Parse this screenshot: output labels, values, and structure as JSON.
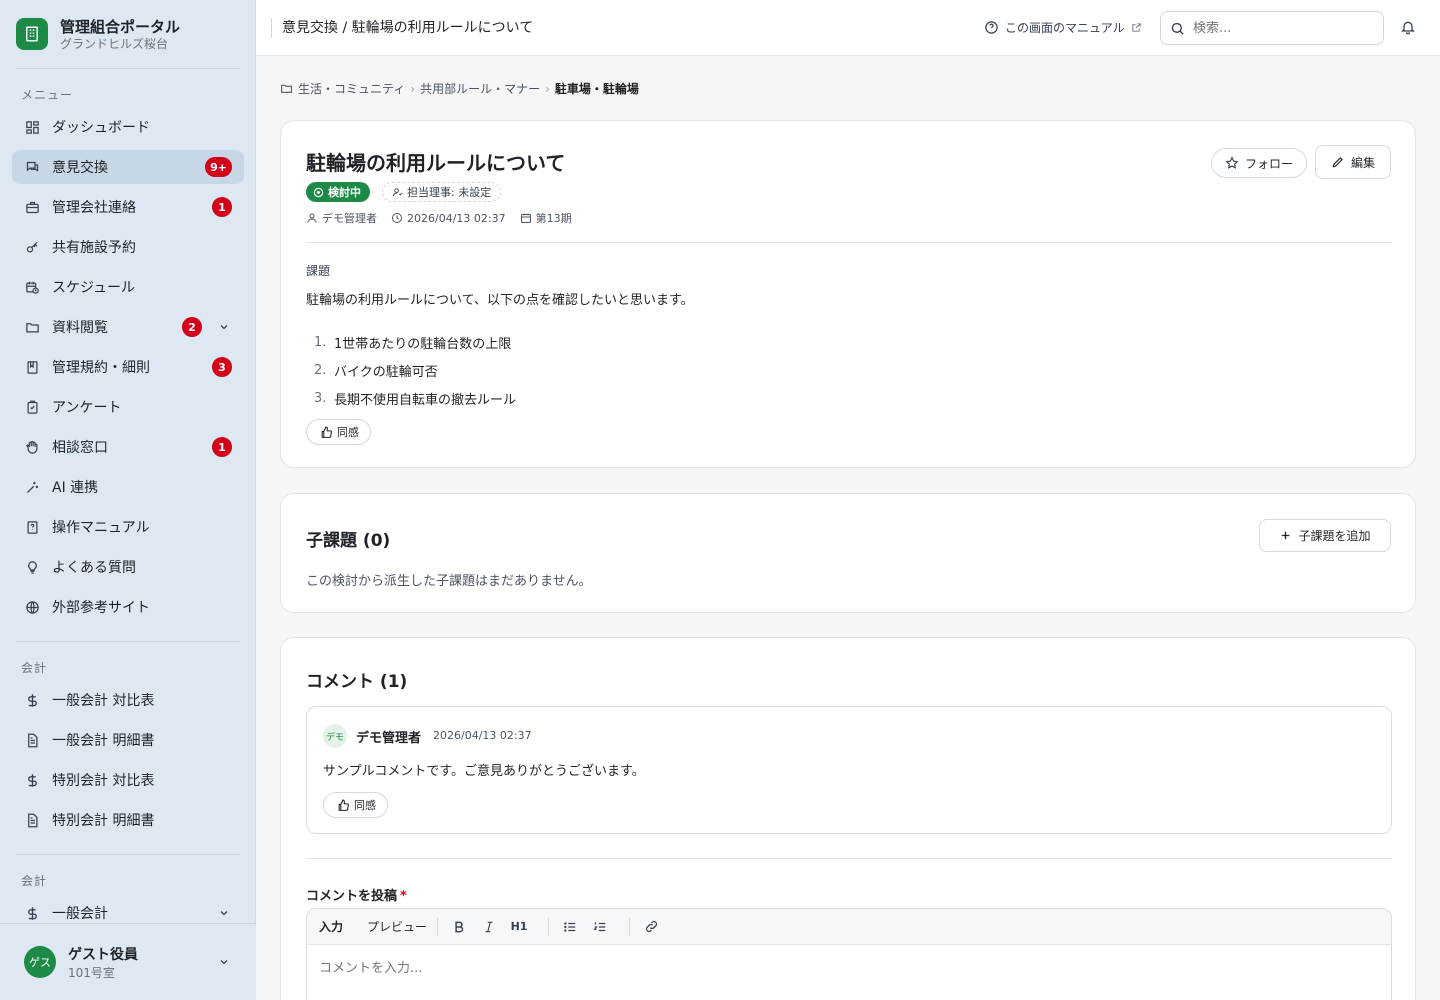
{
  "brand": {
    "title": "管理組合ポータル",
    "subtitle": "グランドヒルズ桜台"
  },
  "sidebar": {
    "section_menu": "メニュー",
    "items": [
      {
        "label": "ダッシュボード",
        "icon": "dashboard-icon"
      },
      {
        "label": "意見交換",
        "icon": "chat-icon",
        "badge": "9+",
        "active": true
      },
      {
        "label": "管理会社連絡",
        "icon": "briefcase-icon",
        "badge": "1"
      },
      {
        "label": "共有施設予約",
        "icon": "key-icon"
      },
      {
        "label": "スケジュール",
        "icon": "calendar-clock-icon"
      },
      {
        "label": "資料閲覧",
        "icon": "folder-icon",
        "badge": "2"
      },
      {
        "label": "管理規約・細則",
        "icon": "book-icon",
        "badge": "3"
      },
      {
        "label": "アンケート",
        "icon": "clipboard-icon"
      },
      {
        "label": "相談窓口",
        "icon": "hand-icon",
        "badge": "1"
      },
      {
        "label": "AI 連携",
        "icon": "sparkle-icon"
      },
      {
        "label": "操作マニュアル",
        "icon": "manual-icon"
      },
      {
        "label": "よくある質問",
        "icon": "lightbulb-icon"
      },
      {
        "label": "外部参考サイト",
        "icon": "globe-icon"
      }
    ],
    "section_accounting": "会計",
    "accounting_items": [
      {
        "label": "一般会計 対比表",
        "icon": "dollar-icon"
      },
      {
        "label": "一般会計 明細書",
        "icon": "document-icon"
      },
      {
        "label": "特別会計 対比表",
        "icon": "dollar-icon"
      },
      {
        "label": "特別会計 明細書",
        "icon": "document-icon"
      }
    ],
    "section_accounting2": "会計",
    "accounting2_items": [
      {
        "label": "一般会計",
        "icon": "dollar-icon"
      }
    ]
  },
  "user": {
    "avatar": "ゲス",
    "name": "ゲスト役員",
    "room": "101号室"
  },
  "header": {
    "crumb": "意見交換 / 駐輪場の利用ルールについて",
    "manual_label": "この画面のマニュアル",
    "search_placeholder": "検索..."
  },
  "breadcrumb": [
    "生活・コミュニティ",
    "共用部ルール・マナー",
    "駐車場・駐輪場"
  ],
  "topic": {
    "title": "駐輪場の利用ルールについて",
    "follow_label": "フォロー",
    "edit_label": "編集",
    "status": "検討中",
    "assignee": "担当理事: 未設定",
    "author": "デモ管理者",
    "datetime": "2026/04/13 02:37",
    "term": "第13期",
    "section_label": "課題",
    "body": "駐輪場の利用ルールについて、以下の点を確認したいと思います。",
    "list": [
      {
        "num": "1.",
        "text": "1世帯あたりの駐輪台数の上限"
      },
      {
        "num": "2.",
        "text": "バイクの駐輪可否"
      },
      {
        "num": "3.",
        "text": "長期不使用自転車の撤去ルール"
      }
    ],
    "agree_label": "同感"
  },
  "subtopics": {
    "heading": "子課題 (0)",
    "add_label": "子課題を追加",
    "empty_text": "この検討から派生した子課題はまだありません。"
  },
  "comments": {
    "heading": "コメント (1)",
    "items": [
      {
        "avatar": "デモ",
        "author": "デモ管理者",
        "time": "2026/04/13 02:37",
        "body": "サンプルコメントです。ご意見ありがとうございます。",
        "agree_label": "同感"
      }
    ],
    "post_label": "コメントを投稿",
    "required_mark": "*",
    "editor": {
      "tab_input": "入力",
      "tab_preview": "プレビュー",
      "h1_label": "H1",
      "placeholder": "コメントを入力..."
    }
  },
  "colors": {
    "accent": "#1e8a48",
    "badge": "#d3001a",
    "sidebar_bg": "#dde8f2"
  }
}
